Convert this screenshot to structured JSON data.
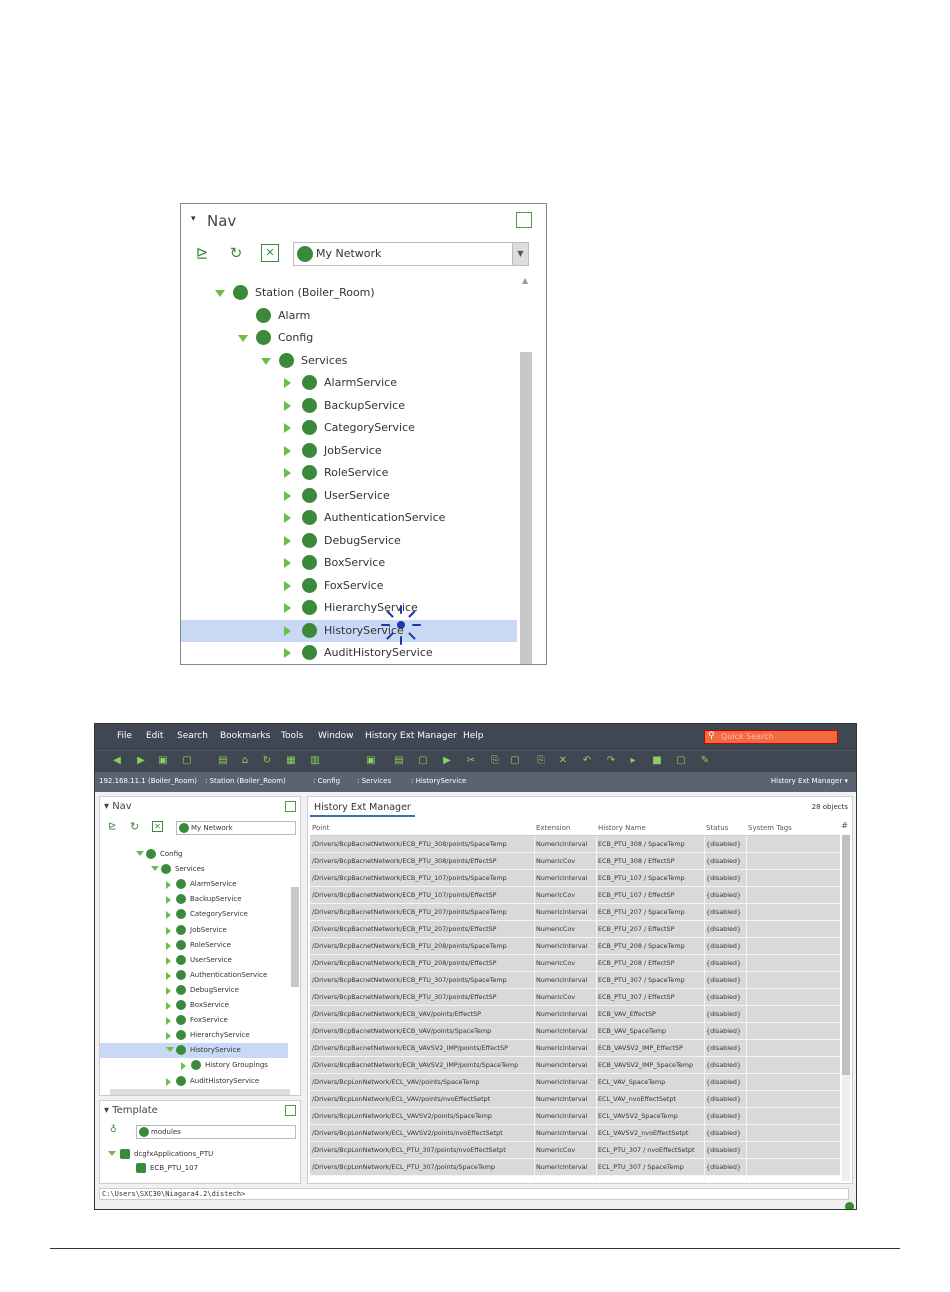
{
  "nav_panel": {
    "title": "Nav",
    "network_select": "My Network",
    "tree": [
      {
        "label": "Station (Boiler_Room)",
        "indent": 0,
        "arrow": "down"
      },
      {
        "label": "Alarm",
        "indent": 1,
        "arrow": "none"
      },
      {
        "label": "Config",
        "indent": 1,
        "arrow": "down"
      },
      {
        "label": "Services",
        "indent": 2,
        "arrow": "down"
      },
      {
        "label": "AlarmService",
        "indent": 3,
        "arrow": "right"
      },
      {
        "label": "BackupService",
        "indent": 3,
        "arrow": "right"
      },
      {
        "label": "CategoryService",
        "indent": 3,
        "arrow": "right"
      },
      {
        "label": "JobService",
        "indent": 3,
        "arrow": "right"
      },
      {
        "label": "RoleService",
        "indent": 3,
        "arrow": "right"
      },
      {
        "label": "UserService",
        "indent": 3,
        "arrow": "right"
      },
      {
        "label": "AuthenticationService",
        "indent": 3,
        "arrow": "right"
      },
      {
        "label": "DebugService",
        "indent": 3,
        "arrow": "right"
      },
      {
        "label": "BoxService",
        "indent": 3,
        "arrow": "right"
      },
      {
        "label": "FoxService",
        "indent": 3,
        "arrow": "right"
      },
      {
        "label": "HierarchyService",
        "indent": 3,
        "arrow": "right"
      },
      {
        "label": "HistoryService",
        "indent": 3,
        "arrow": "right",
        "selected": true
      },
      {
        "label": "AuditHistoryService",
        "indent": 3,
        "arrow": "right"
      }
    ]
  },
  "app": {
    "menu": [
      "File",
      "Edit",
      "Search",
      "Bookmarks",
      "Tools",
      "Window",
      "History Ext Manager",
      "Help"
    ],
    "quick_search_placeholder": "Quick Search",
    "address": [
      "192.168.11.1 (Boiler_Room)",
      "Station (Boiler_Room)",
      "Config",
      "Services",
      "HistoryService"
    ],
    "view_selector": "History Ext Manager",
    "left_nav": {
      "title": "Nav",
      "network_select": "My Network",
      "tree": [
        {
          "label": "Config",
          "indent": 0,
          "arrow": "down"
        },
        {
          "label": "Services",
          "indent": 1,
          "arrow": "down"
        },
        {
          "label": "AlarmService",
          "indent": 2,
          "arrow": "right"
        },
        {
          "label": "BackupService",
          "indent": 2,
          "arrow": "right"
        },
        {
          "label": "CategoryService",
          "indent": 2,
          "arrow": "right"
        },
        {
          "label": "JobService",
          "indent": 2,
          "arrow": "right"
        },
        {
          "label": "RoleService",
          "indent": 2,
          "arrow": "right"
        },
        {
          "label": "UserService",
          "indent": 2,
          "arrow": "right"
        },
        {
          "label": "AuthenticationService",
          "indent": 2,
          "arrow": "right"
        },
        {
          "label": "DebugService",
          "indent": 2,
          "arrow": "right"
        },
        {
          "label": "BoxService",
          "indent": 2,
          "arrow": "right"
        },
        {
          "label": "FoxService",
          "indent": 2,
          "arrow": "right"
        },
        {
          "label": "HierarchyService",
          "indent": 2,
          "arrow": "right"
        },
        {
          "label": "HistoryService",
          "indent": 2,
          "arrow": "down",
          "selected": true
        },
        {
          "label": "History Groupings",
          "indent": 3,
          "arrow": "right"
        },
        {
          "label": "AuditHistoryService",
          "indent": 2,
          "arrow": "right"
        }
      ]
    },
    "template": {
      "title": "Template",
      "select": "modules",
      "tree": [
        {
          "label": "dcgfxApplications_PTU",
          "indent": 0,
          "arrow": "down"
        },
        {
          "label": "ECB_PTU_107",
          "indent": 1,
          "arrow": "none"
        }
      ]
    },
    "main": {
      "tab": "History Ext Manager",
      "count": "28 objects",
      "columns": [
        "Point",
        "Extension",
        "History Name",
        "Status",
        "System Tags"
      ],
      "rows": [
        [
          "/Drivers/BcpBacnetNetwork/ECB_PTU_308/points/SpaceTemp",
          "NumericInterval",
          "ECB_PTU_308 / SpaceTemp",
          "{disabled}",
          ""
        ],
        [
          "/Drivers/BcpBacnetNetwork/ECB_PTU_308/points/EffectSP",
          "NumericCov",
          "ECB_PTU_308 / EffectSP",
          "{disabled}",
          ""
        ],
        [
          "/Drivers/BcpBacnetNetwork/ECB_PTU_107/points/SpaceTemp",
          "NumericInterval",
          "ECB_PTU_107 / SpaceTemp",
          "{disabled}",
          ""
        ],
        [
          "/Drivers/BcpBacnetNetwork/ECB_PTU_107/points/EffectSP",
          "NumericCov",
          "ECB_PTU_107 / EffectSP",
          "{disabled}",
          ""
        ],
        [
          "/Drivers/BcpBacnetNetwork/ECB_PTU_207/points/SpaceTemp",
          "NumericInterval",
          "ECB_PTU_207 / SpaceTemp",
          "{disabled}",
          ""
        ],
        [
          "/Drivers/BcpBacnetNetwork/ECB_PTU_207/points/EffectSP",
          "NumericCov",
          "ECB_PTU_207 / EffectSP",
          "{disabled}",
          ""
        ],
        [
          "/Drivers/BcpBacnetNetwork/ECB_PTU_208/points/SpaceTemp",
          "NumericInterval",
          "ECB_PTU_208 / SpaceTemp",
          "{disabled}",
          ""
        ],
        [
          "/Drivers/BcpBacnetNetwork/ECB_PTU_208/points/EffectSP",
          "NumericCov",
          "ECB_PTU_208 / EffectSP",
          "{disabled}",
          ""
        ],
        [
          "/Drivers/BcpBacnetNetwork/ECB_PTU_307/points/SpaceTemp",
          "NumericInterval",
          "ECB_PTU_307 / SpaceTemp",
          "{disabled}",
          ""
        ],
        [
          "/Drivers/BcpBacnetNetwork/ECB_PTU_307/points/EffectSP",
          "NumericCov",
          "ECB_PTU_307 / EffectSP",
          "{disabled}",
          ""
        ],
        [
          "/Drivers/BcpBacnetNetwork/ECB_VAV/points/EffectSP",
          "NumericInterval",
          "ECB_VAV_EffectSP",
          "{disabled}",
          ""
        ],
        [
          "/Drivers/BcpBacnetNetwork/ECB_VAV/points/SpaceTemp",
          "NumericInterval",
          "ECB_VAV_SpaceTemp",
          "{disabled}",
          ""
        ],
        [
          "/Drivers/BcpBacnetNetwork/ECB_VAVSV2_IMP/points/EffectSP",
          "NumericInterval",
          "ECB_VAVSV2_IMP_EffectSP",
          "{disabled}",
          ""
        ],
        [
          "/Drivers/BcpBacnetNetwork/ECB_VAVSV2_IMP/points/SpaceTemp",
          "NumericInterval",
          "ECB_VAVSV2_IMP_SpaceTemp",
          "{disabled}",
          ""
        ],
        [
          "/Drivers/BcpLonNetwork/ECL_VAV/points/SpaceTemp",
          "NumericInterval",
          "ECL_VAV_SpaceTemp",
          "{disabled}",
          ""
        ],
        [
          "/Drivers/BcpLonNetwork/ECL_VAV/points/nvoEffectSetpt",
          "NumericInterval",
          "ECL_VAV_nvoEffectSetpt",
          "{disabled}",
          ""
        ],
        [
          "/Drivers/BcpLonNetwork/ECL_VAVSV2/points/SpaceTemp",
          "NumericInterval",
          "ECL_VAVSV2_SpaceTemp",
          "{disabled}",
          ""
        ],
        [
          "/Drivers/BcpLonNetwork/ECL_VAVSV2/points/nvoEffectSetpt",
          "NumericInterval",
          "ECL_VAVSV2_nvoEffectSetpt",
          "{disabled}",
          ""
        ],
        [
          "/Drivers/BcpLonNetwork/ECL_PTU_307/points/nvoEffectSetpt",
          "NumericCov",
          "ECL_PTU_307 / nvoEffectSetpt",
          "{disabled}",
          ""
        ],
        [
          "/Drivers/BcpLonNetwork/ECL_PTU_307/points/SpaceTemp",
          "NumericInterval",
          "ECL_PTU_307 / SpaceTemp",
          "{disabled}",
          ""
        ]
      ]
    },
    "console": "C:\\Users\\SXC30\\Niagara4.2\\distech>"
  }
}
